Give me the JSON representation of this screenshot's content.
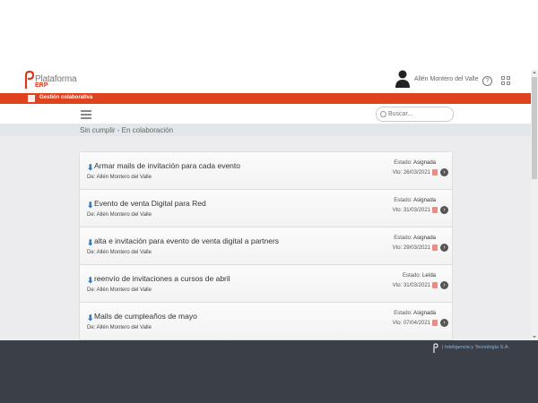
{
  "header": {
    "logo_title": "Plataforma",
    "logo_sub": "ERP",
    "user_name": "Allén Montero del Valle"
  },
  "module": {
    "label": "Gestión colaborativa"
  },
  "search": {
    "placeholder": "Buscar..."
  },
  "breadcrumb": "Sin cumplir - En colaboración",
  "tasks": [
    {
      "title": "Armar mails de invitación para cada evento",
      "from": "De: Allén Montero del Valle",
      "state_label": "Estado:",
      "state": "Asignada",
      "vto_label": "Vto:",
      "due": "26/03/2021"
    },
    {
      "title": "Evento de venta Digital para Red",
      "from": "De: Allén Montero del Valle",
      "state_label": "Estado:",
      "state": "Asignada",
      "vto_label": "Vto:",
      "due": "31/03/2021"
    },
    {
      "title": "alta e invitación para evento de venta digital a partners",
      "from": "De: Allén Montero del Valle",
      "state_label": "Estado:",
      "state": "Asignada",
      "vto_label": "Vto:",
      "due": "29/03/2021"
    },
    {
      "title": "reenvío de invitaciones a cursos de abril",
      "from": "De: Allén Montero del Valle",
      "state_label": "Estado:",
      "state": "Leída",
      "vto_label": "Vto:",
      "due": "31/03/2021"
    },
    {
      "title": "Mails de cumpleaños de mayo",
      "from": "De: Allén Montero del Valle",
      "state_label": "Estado:",
      "state": "Asignada",
      "vto_label": "Vto:",
      "due": "07/04/2021"
    }
  ],
  "footer": {
    "company": "| Inteligencia y Tecnología S.A."
  },
  "colors": {
    "brand_red": "#e0411e",
    "footer_bg": "#3b4048",
    "arrow_blue": "#2f78d0"
  },
  "icons": {
    "user": "person-icon",
    "help": "question-circle-icon",
    "apps": "grid-icon",
    "menu": "hamburger-icon",
    "search": "search-icon",
    "arrow": "arrow-down-icon",
    "go": "chevron-right-circle-icon"
  }
}
